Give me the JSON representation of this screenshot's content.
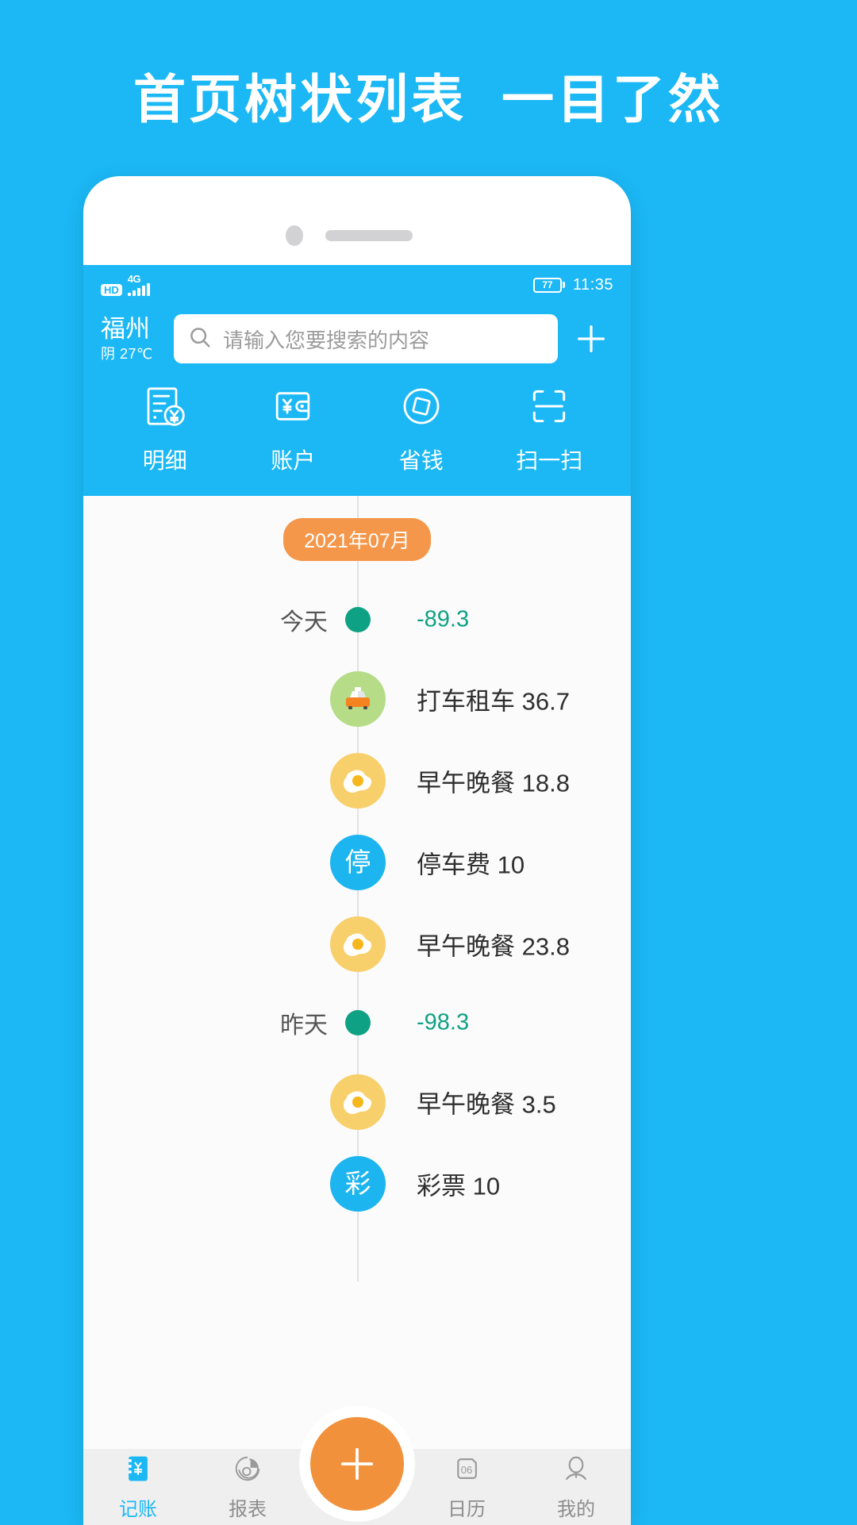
{
  "headline": {
    "part1": "首页树状列表",
    "part2": "一目了然"
  },
  "status_bar": {
    "hd_label": "HD",
    "network": "4G",
    "battery_level": "77",
    "time": "11:35"
  },
  "header": {
    "city": "福州",
    "weather": "阴 27℃",
    "search_placeholder": "请输入您要搜索的内容",
    "add_icon": "plus-icon",
    "quick_actions": [
      {
        "label": "明细",
        "icon": "receipt-yen-icon"
      },
      {
        "label": "账户",
        "icon": "wallet-yen-icon"
      },
      {
        "label": "省钱",
        "icon": "diamond-circle-icon"
      },
      {
        "label": "扫一扫",
        "icon": "scan-frame-icon"
      }
    ]
  },
  "timeline": {
    "month_badge": "2021年07月",
    "groups": [
      {
        "day_label": "今天",
        "amount": "-89.3",
        "entries": [
          {
            "icon": "taxi-icon",
            "icon_bg": "#B6DC87",
            "text": "打车租车 36.7"
          },
          {
            "icon": "fried-egg-icon",
            "icon_bg": "#F8D06B",
            "text": "早午晚餐 18.8"
          },
          {
            "icon": "parking-icon",
            "icon_bg": "#1CB5F0",
            "glyph": "停",
            "text": "停车费 10"
          },
          {
            "icon": "fried-egg-icon",
            "icon_bg": "#F8D06B",
            "text": "早午晚餐 23.8"
          }
        ]
      },
      {
        "day_label": "昨天",
        "amount": "-98.3",
        "entries": [
          {
            "icon": "fried-egg-icon",
            "icon_bg": "#F8D06B",
            "text": "早午晚餐 3.5"
          },
          {
            "icon": "lottery-icon",
            "icon_bg": "#1CB5F0",
            "glyph": "彩",
            "text": "彩票 10"
          }
        ]
      }
    ]
  },
  "tabbar": {
    "items": [
      {
        "label": "记账",
        "icon": "ledger-yen-icon",
        "active": true
      },
      {
        "label": "报表",
        "icon": "pie-chart-icon",
        "active": false
      },
      {
        "label": "日历",
        "icon": "calendar-06-icon",
        "active": false
      },
      {
        "label": "我的",
        "icon": "person-icon",
        "active": false
      }
    ],
    "fab_icon": "plus-icon"
  },
  "colors": {
    "brand_blue": "#1BB8F5",
    "accent_orange": "#F2913B",
    "month_badge_orange": "#F4974B",
    "teal": "#0FA184",
    "tab_inactive": "#8d8d8d"
  }
}
